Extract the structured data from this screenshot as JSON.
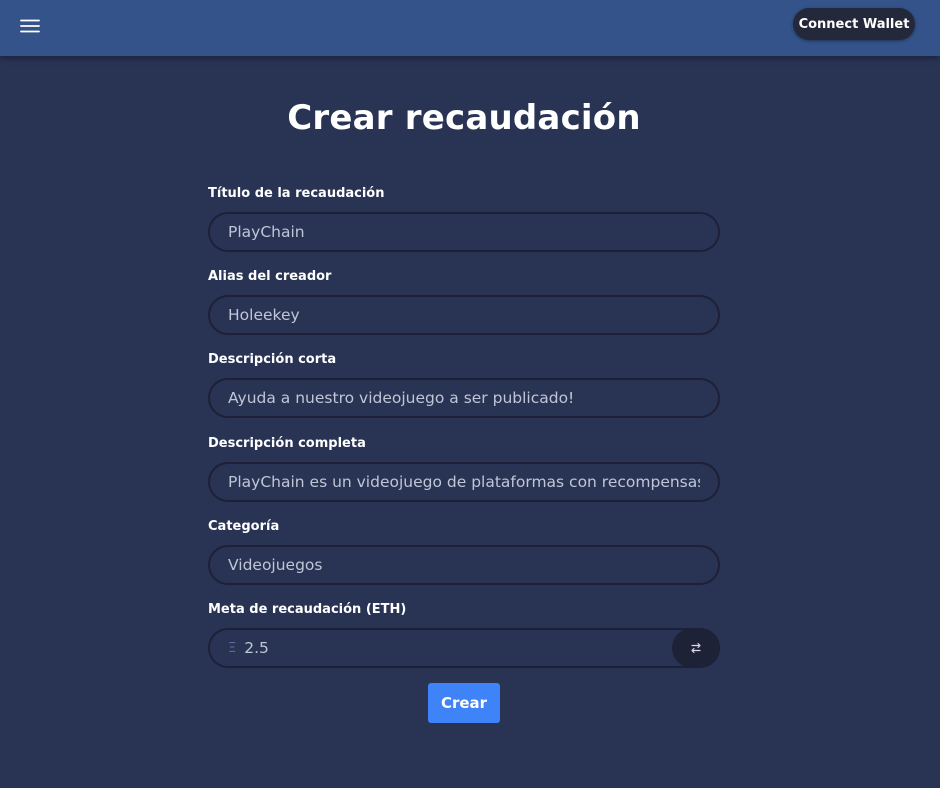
{
  "header": {
    "menu_icon": "hamburger-menu-icon",
    "connect_wallet_label": "Connect Wallet"
  },
  "page": {
    "title": "Crear recaudación"
  },
  "form": {
    "fields": [
      {
        "label": "Título de la recaudación",
        "value": "PlayChain"
      },
      {
        "label": "Alias del creador",
        "value": "Holeekey"
      },
      {
        "label": "Descripción corta",
        "value": "Ayuda a nuestro videojuego a ser publicado!"
      },
      {
        "label": "Descripción completa",
        "value": "PlayChain es un videojuego de plataformas con recompensas en l"
      },
      {
        "label": "Categoría",
        "value": "Videojuegos"
      }
    ],
    "goal": {
      "label": "Meta de recaudación (ETH)",
      "currency_symbol": "Ξ",
      "value": "2.5",
      "swap_icon": "swap-arrows-icon"
    },
    "submit_label": "Crear"
  },
  "colors": {
    "background": "#293354",
    "topbar": "#34538a",
    "input_border": "#1d2036",
    "dark_button": "#24283b",
    "primary_button": "#3f83f8",
    "input_text": "#c0c6d6"
  }
}
